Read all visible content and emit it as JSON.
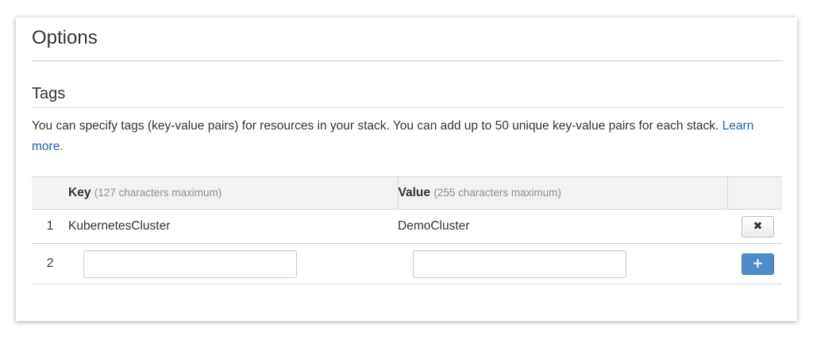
{
  "page_title": "Options",
  "tags_section": {
    "title": "Tags",
    "description": "You can specify tags (key-value pairs) for resources in your stack. You can add up to 50 unique key-value pairs for each stack.",
    "learn_more": "Learn more."
  },
  "table": {
    "key_header": "Key",
    "key_hint": "(127 characters maximum)",
    "value_header": "Value",
    "value_hint": "(255 characters maximum)",
    "rows": [
      {
        "index": "1",
        "key": "KubernetesCluster",
        "value": "DemoCluster",
        "action_icon": "close-icon"
      },
      {
        "index": "2",
        "key": "",
        "value": "",
        "action_icon": "plus-icon"
      }
    ]
  },
  "icons": {
    "remove_glyph": "✖",
    "add_glyph": "+"
  },
  "colors": {
    "link": "#1f5ea8",
    "add_button": "#4f8dca",
    "header_bg": "#f2f2f2"
  }
}
